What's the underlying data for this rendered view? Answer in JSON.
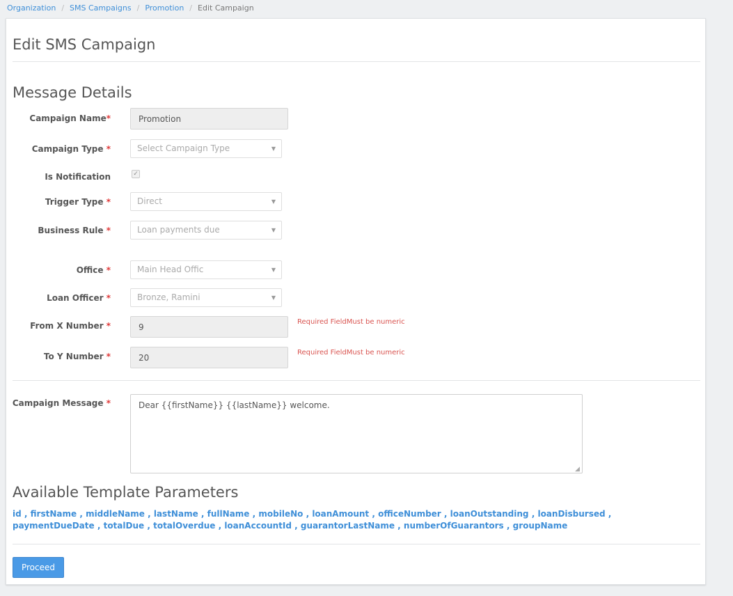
{
  "breadcrumb": {
    "items": [
      "Organization",
      "SMS Campaigns",
      "Promotion"
    ],
    "current": "Edit Campaign"
  },
  "page_title": "Edit SMS Campaign",
  "message_details": {
    "title": "Message Details",
    "required_marker": "*",
    "campaign_name": {
      "label": "Campaign Name",
      "value": "Promotion"
    },
    "campaign_type": {
      "label": "Campaign Type",
      "placeholder": "Select Campaign Type"
    },
    "is_notification": {
      "label": "Is Notification",
      "checked": true
    },
    "trigger_type": {
      "label": "Trigger Type",
      "value": "Direct"
    },
    "business_rule": {
      "label": "Business Rule",
      "value": "Loan payments due"
    },
    "office": {
      "label": "Office",
      "value": "Main Head Offic"
    },
    "loan_officer": {
      "label": "Loan Officer",
      "value": "Bronze, Ramini"
    },
    "from_x": {
      "label": "From X Number",
      "value": "9",
      "error": "Required FieldMust be numeric"
    },
    "to_y": {
      "label": "To Y Number",
      "value": "20",
      "error": "Required FieldMust be numeric"
    },
    "campaign_message": {
      "label": "Campaign Message",
      "value": "Dear {{firstName}} {{lastName}} welcome."
    }
  },
  "template_parameters": {
    "title": "Available Template Parameters",
    "items": [
      "id",
      "firstName",
      "middleName",
      "lastName",
      "fullName",
      "mobileNo",
      "loanAmount",
      "officeNumber",
      "loanOutstanding",
      "loanDisbursed",
      "paymentDueDate",
      "totalDue",
      "totalOverdue",
      "loanAccountId",
      "guarantorLastName",
      "numberOfGuarantors",
      "groupName"
    ],
    "separator": ","
  },
  "proceed_label": "Proceed",
  "icons": {
    "dropdown": "caret-down-icon",
    "checkmark": "check-icon",
    "resize": "resize-grip-icon"
  }
}
